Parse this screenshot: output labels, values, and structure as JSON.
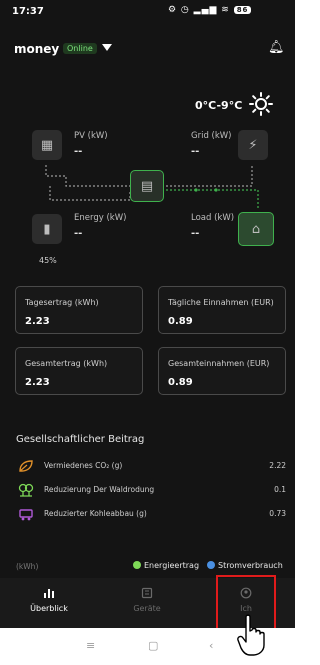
{
  "status_bar": {
    "time": "17:37",
    "icons_text": "⚙ ◷ ▂▄▆ ≋",
    "battery": "86"
  },
  "header": {
    "station_name": "money",
    "status": "Online",
    "temperature": "0°C-9°C"
  },
  "flow": {
    "pv": {
      "label": "PV (kW)",
      "value": "--"
    },
    "grid": {
      "label": "Grid (kW)",
      "value": "--"
    },
    "energy": {
      "label": "Energy (kW)",
      "value": "--"
    },
    "load": {
      "label": "Load (kW)",
      "value": "--"
    },
    "battery_soc": "45%"
  },
  "cards": [
    {
      "label": "Tagesertrag (kWh)",
      "value": "2.23"
    },
    {
      "label": "Tägliche Einnahmen (EUR)",
      "value": "0.89"
    },
    {
      "label": "Gesamtertrag (kWh)",
      "value": "2.23"
    },
    {
      "label": "Gesamteinnahmen (EUR)",
      "value": "0.89"
    }
  ],
  "contribution": {
    "title": "Gesellschaftlicher Beitrag",
    "rows": [
      {
        "label": "Vermiedenes CO₂ (g)",
        "value": "2.22",
        "icon": "leaf-icon"
      },
      {
        "label": "Reduzierung Der Waldrodung",
        "value": "0.1",
        "icon": "tree-icon"
      },
      {
        "label": "Reduzierter Kohleabbau (g)",
        "value": "0.73",
        "icon": "coal-cart-icon"
      }
    ]
  },
  "legend": {
    "unit": "(kWh)",
    "items": [
      {
        "label": "Energieertrag",
        "color": "#7ed957"
      },
      {
        "label": "Stromverbrauch",
        "color": "#4a90e2"
      }
    ]
  },
  "bottom_nav": [
    {
      "label": "Überblick",
      "icon": "bar-chart-icon",
      "active": true
    },
    {
      "label": "Geräte",
      "icon": "device-icon",
      "active": false
    },
    {
      "label": "Ich",
      "icon": "user-icon",
      "active": false
    }
  ],
  "colors": {
    "accent_green": "#3fb14d",
    "background": "#141414",
    "highlight_red": "#e01b1b"
  }
}
